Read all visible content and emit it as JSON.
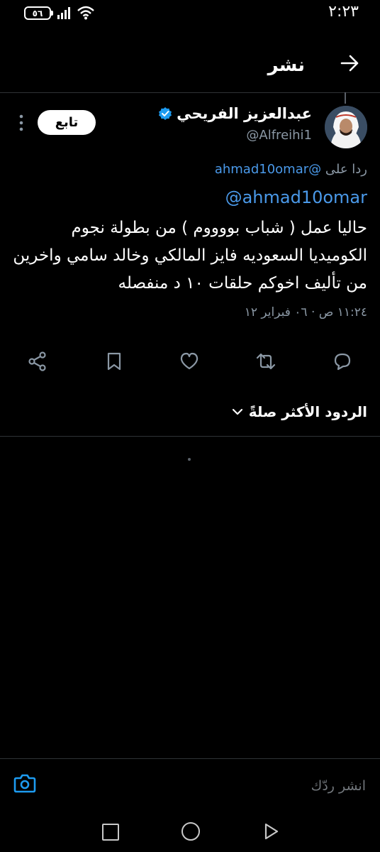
{
  "status_bar": {
    "time": "٢:٢٣",
    "battery": "٥٦"
  },
  "header": {
    "title": "نشر"
  },
  "author": {
    "name": "عبدالعزيز الفريحي",
    "handle": "@Alfreihi1",
    "follow_label": "تابع"
  },
  "reply_to": {
    "prefix": "ردا على",
    "mention": "@ahmad10omar"
  },
  "tweet": {
    "mention": "@ahmad10omar",
    "text": "حاليا عمل ( شباب بووووم ) من بطولة نجوم الكوميديا السعوديه فايز المالكي وخالد سامي واخرين من تأليف اخوكم حلقات ١٠ د منفصله",
    "timestamp": "١١:٢٤ ص · ٠٦ فبراير ١٢"
  },
  "actions": [
    "reply-icon",
    "retweet-icon",
    "like-icon",
    "bookmark-icon",
    "share-icon"
  ],
  "replies_filter": {
    "label": "الردود الأكثر صلةً"
  },
  "composer": {
    "placeholder": "انشر ردّك"
  },
  "colors": {
    "background": "#000000",
    "accent": "#4a99e9",
    "muted": "#8b98a5",
    "divider": "#2f3336"
  }
}
